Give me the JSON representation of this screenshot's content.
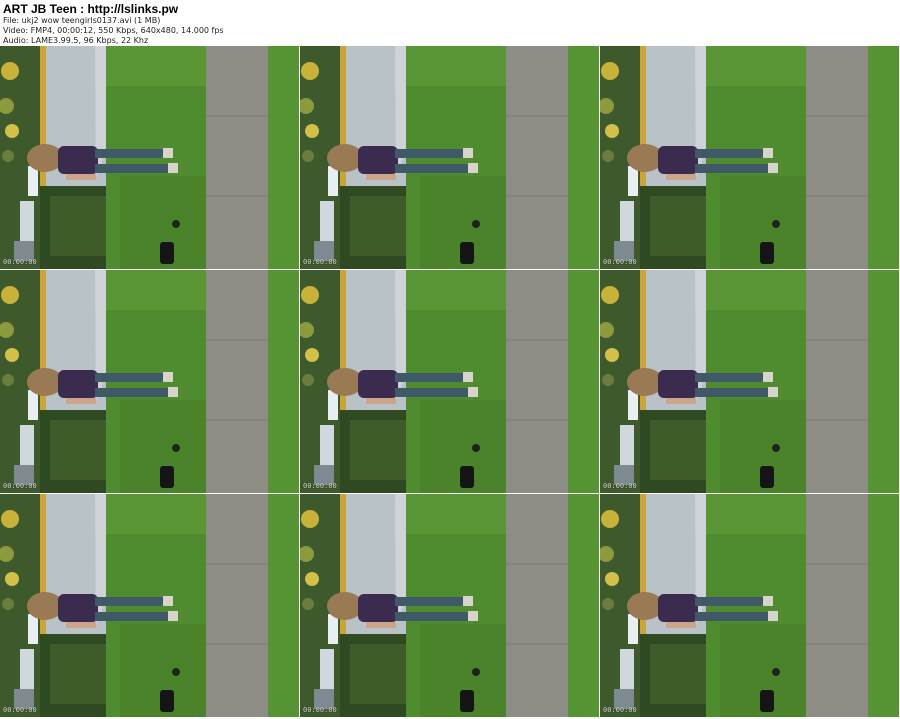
{
  "header": {
    "title": "ART JB Teen : http://lslinks.pw",
    "file": "File: ukj2 wow teengirls0137.avi (1 MB)",
    "video": "Video: FMP4, 00:00:12, 550 Kbps, 640x480, 14.000 fps",
    "audio": "Audio: LAME3.99.5, 96 Kbps, 22 Khz"
  },
  "thumbnails": [
    {
      "timestamp": "00:00:00"
    },
    {
      "timestamp": "00:00:00"
    },
    {
      "timestamp": "00:00:00"
    },
    {
      "timestamp": "00:00:00"
    },
    {
      "timestamp": "00:00:00"
    },
    {
      "timestamp": "00:00:00"
    },
    {
      "timestamp": "00:00:00"
    },
    {
      "timestamp": "00:00:00"
    },
    {
      "timestamp": "00:00:00"
    }
  ],
  "colors": {
    "grass": "#4e8a2e",
    "sidewalk": "#8d8c84",
    "road": "#b7bfc4",
    "shirt": "#3b2b4e",
    "jeans": "#3f5a66",
    "hair": "#9a7a55",
    "hedge": "#2f4a22"
  }
}
